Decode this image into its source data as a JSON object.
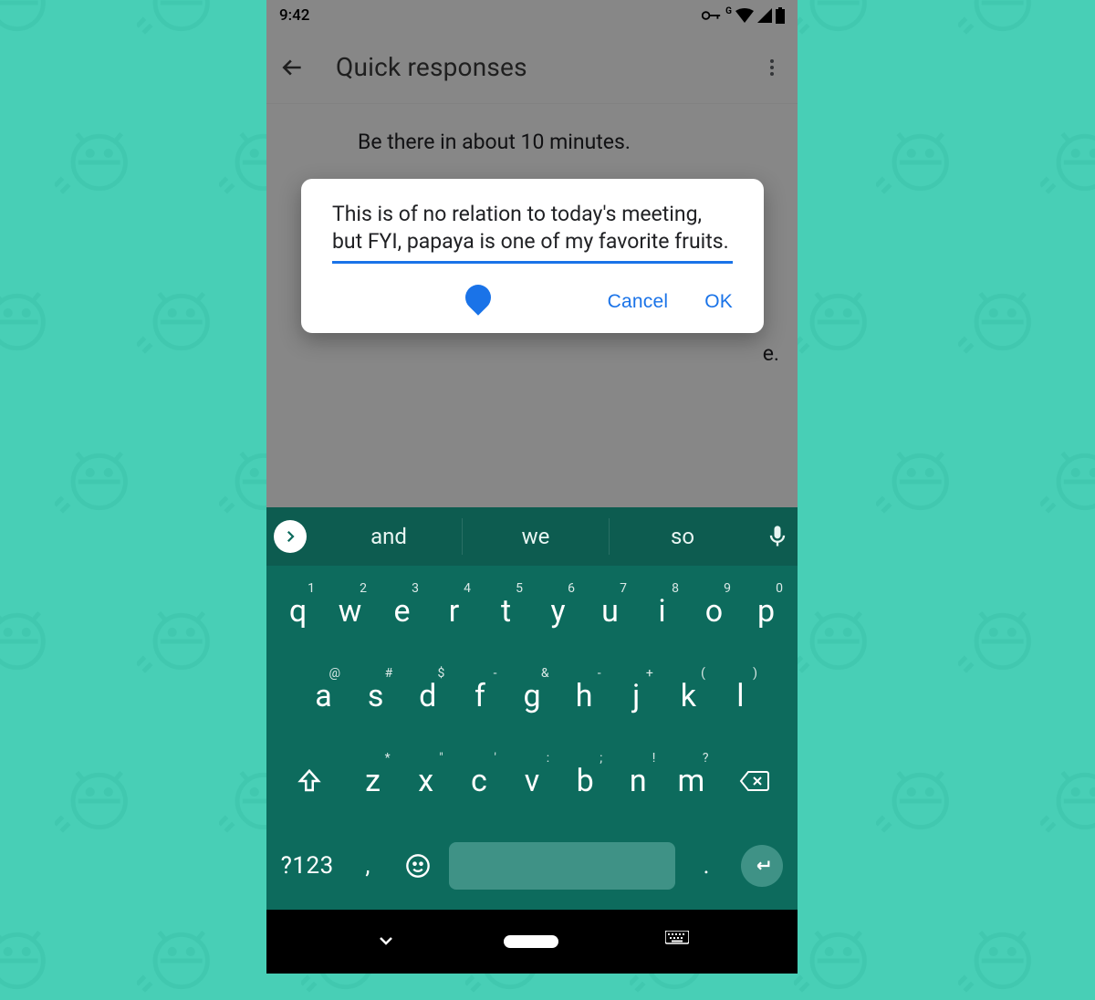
{
  "status": {
    "time": "9:42"
  },
  "header": {
    "title": "Quick responses"
  },
  "responses": {
    "item1": "Be there in about 10 minutes.",
    "partial": "e."
  },
  "dialog": {
    "text": "This is of no relation to today's meeting, but FYI, papaya is one of my favorite fruits.",
    "cancel": "Cancel",
    "ok": "OK"
  },
  "keyboard": {
    "suggestions": [
      "and",
      "we",
      "so"
    ],
    "row1": [
      {
        "k": "q",
        "s": "1"
      },
      {
        "k": "w",
        "s": "2"
      },
      {
        "k": "e",
        "s": "3"
      },
      {
        "k": "r",
        "s": "4"
      },
      {
        "k": "t",
        "s": "5"
      },
      {
        "k": "y",
        "s": "6"
      },
      {
        "k": "u",
        "s": "7"
      },
      {
        "k": "i",
        "s": "8"
      },
      {
        "k": "o",
        "s": "9"
      },
      {
        "k": "p",
        "s": "0"
      }
    ],
    "row2": [
      {
        "k": "a",
        "s": "@"
      },
      {
        "k": "s",
        "s": "#"
      },
      {
        "k": "d",
        "s": "$"
      },
      {
        "k": "f",
        "s": "-"
      },
      {
        "k": "g",
        "s": "&"
      },
      {
        "k": "h",
        "s": "-"
      },
      {
        "k": "j",
        "s": "+"
      },
      {
        "k": "k",
        "s": "("
      },
      {
        "k": "l",
        "s": ")"
      }
    ],
    "row3": [
      {
        "k": "z",
        "s": "*"
      },
      {
        "k": "x",
        "s": "\""
      },
      {
        "k": "c",
        "s": "'"
      },
      {
        "k": "v",
        "s": ":"
      },
      {
        "k": "b",
        "s": ";"
      },
      {
        "k": "n",
        "s": "!"
      },
      {
        "k": "m",
        "s": "?"
      }
    ],
    "numLabel": "?123",
    "comma": ",",
    "period": "."
  }
}
